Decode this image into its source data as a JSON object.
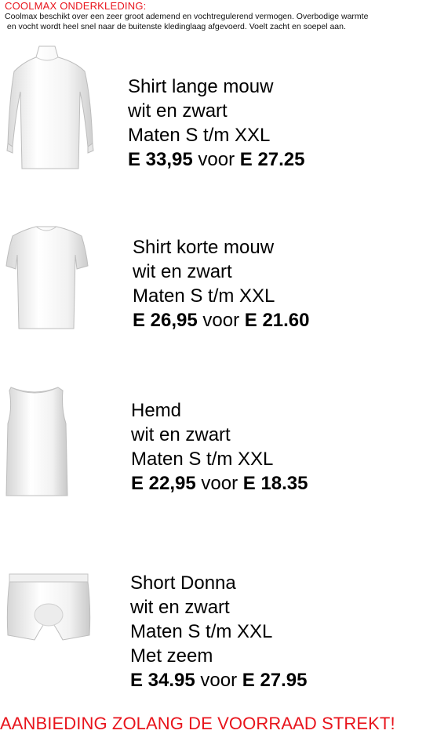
{
  "title": "COOLMAX ONDERKLEDING:",
  "intro": "Coolmax beschikt over een zeer groot ademend en vochtregulerend vermogen. Overbodige warmte\n en vocht wordt heel snel naar de buitenste kledinglaag afgevoerd. Voelt zacht en soepel aan.",
  "products": [
    {
      "name": "Shirt lange mouw",
      "color": "wit en zwart",
      "sizes": "Maten S t/m XXL",
      "extra": "",
      "old_price": "E 33,95",
      "voor": "voor",
      "new_price": "E 27.25"
    },
    {
      "name": "Shirt korte mouw",
      "color": "wit en zwart",
      "sizes": "Maten S t/m XXL",
      "extra": "",
      "old_price": "E 26,95",
      "voor": "voor",
      "new_price": "E 21.60"
    },
    {
      "name": "Hemd",
      "color": "wit en zwart",
      "sizes": "Maten S t/m XXL",
      "extra": "",
      "old_price": "E 22,95",
      "voor": "voor",
      "new_price": "E 18.35"
    },
    {
      "name": "Short Donna",
      "color": "wit en zwart",
      "sizes": "Maten S t/m XXL",
      "extra": "Met zeem",
      "old_price": "E 34.95",
      "voor": "voor",
      "new_price": "E 27.95"
    }
  ],
  "footer": "AANBIEDING ZOLANG DE VOORRAAD STREKT!",
  "colors": {
    "accent_red": "#e8141c",
    "text": "#000000"
  }
}
